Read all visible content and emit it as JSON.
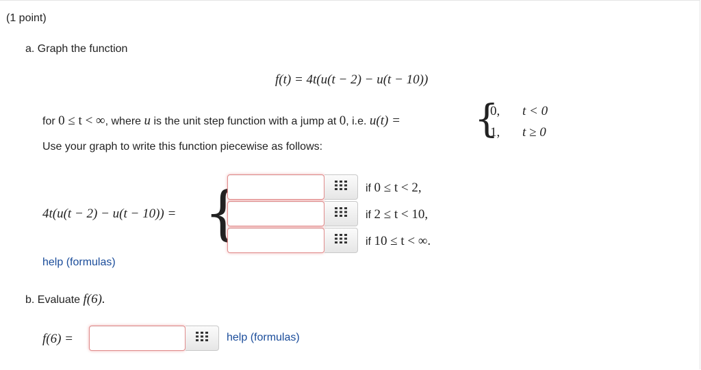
{
  "header": {
    "points": "(1 point)"
  },
  "part_a": {
    "label": "a. Graph the function",
    "equation": "f(t) = 4t(u(t − 2) − u(t − 10))",
    "for_text_1": "for",
    "domain": "0 ≤ t < ∞",
    "for_text_2": ", where",
    "u_var": "u",
    "for_text_3": "is the unit step function with a jump at",
    "zero": "0",
    "for_text_4": ", i.e.",
    "u_def": "u(t) =",
    "cases": [
      {
        "value": "0,",
        "condition": "t < 0"
      },
      {
        "value": "1,",
        "condition": "t ≥ 0"
      }
    ],
    "instruction": "Use your graph to write this function piecewise as follows:",
    "piecewise_lhs": "4t(u(t − 2) − u(t − 10)) =",
    "rows": [
      {
        "value": "",
        "if_text": "if",
        "condition": "0 ≤ t < 2,"
      },
      {
        "value": "",
        "if_text": "if",
        "condition": "2 ≤ t < 10,"
      },
      {
        "value": "",
        "if_text": "if",
        "condition": "10 ≤ t < ∞."
      }
    ],
    "help_link": "help (formulas)"
  },
  "part_b": {
    "label": "b. Evaluate",
    "expr": "f(6).",
    "lhs": "f(6) =",
    "value": "",
    "help_link": "help (formulas)"
  },
  "colors": {
    "link": "#1a4c9a",
    "input_border_error": "#e08b8b"
  },
  "icons": {
    "equation_editor": "grid-icon"
  }
}
